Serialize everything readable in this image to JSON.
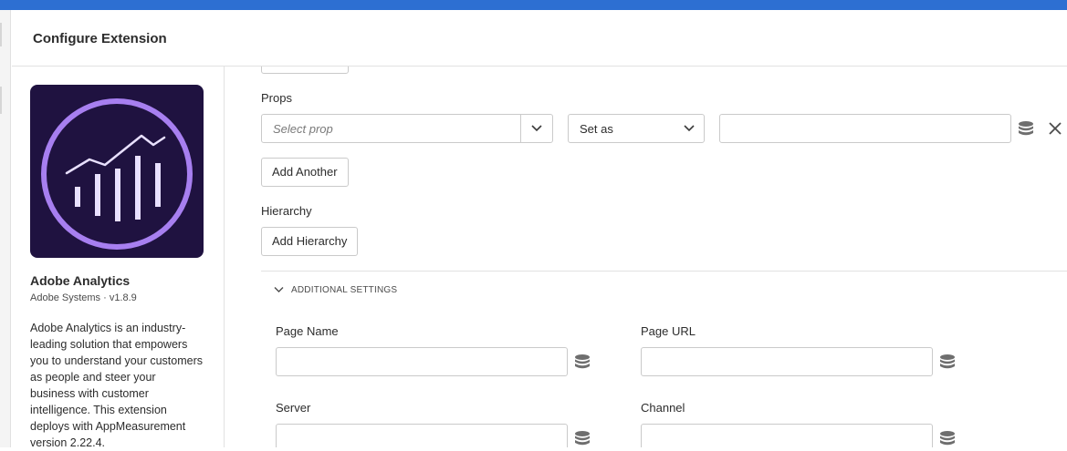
{
  "header": {
    "title": "Configure Extension"
  },
  "extension": {
    "name": "Adobe Analytics",
    "meta": "Adobe Systems · v1.8.9",
    "description": "Adobe Analytics is an industry-leading solution that empowers you to understand your customers as people and steer your business with customer intelligence. This extension deploys with AppMeasurement version 2.22.4."
  },
  "props": {
    "label": "Props",
    "select_placeholder": "Select prop",
    "set_as": "Set as",
    "value": ""
  },
  "buttons": {
    "add_another": "Add Another",
    "add_hierarchy": "Add Hierarchy"
  },
  "hierarchy": {
    "label": "Hierarchy"
  },
  "additional": {
    "toggle_label": "ADDITIONAL SETTINGS",
    "page_name_label": "Page Name",
    "page_url_label": "Page URL",
    "server_label": "Server",
    "channel_label": "Channel"
  },
  "colors": {
    "topbar": "#2d6fd2",
    "logo_bg": "#1f1240",
    "logo_ring": "#a77ff0"
  },
  "icons": {
    "data_element": "database-icon",
    "remove": "close-icon",
    "dropdown": "chevron-down-icon",
    "collapse": "chevron-down-icon"
  }
}
